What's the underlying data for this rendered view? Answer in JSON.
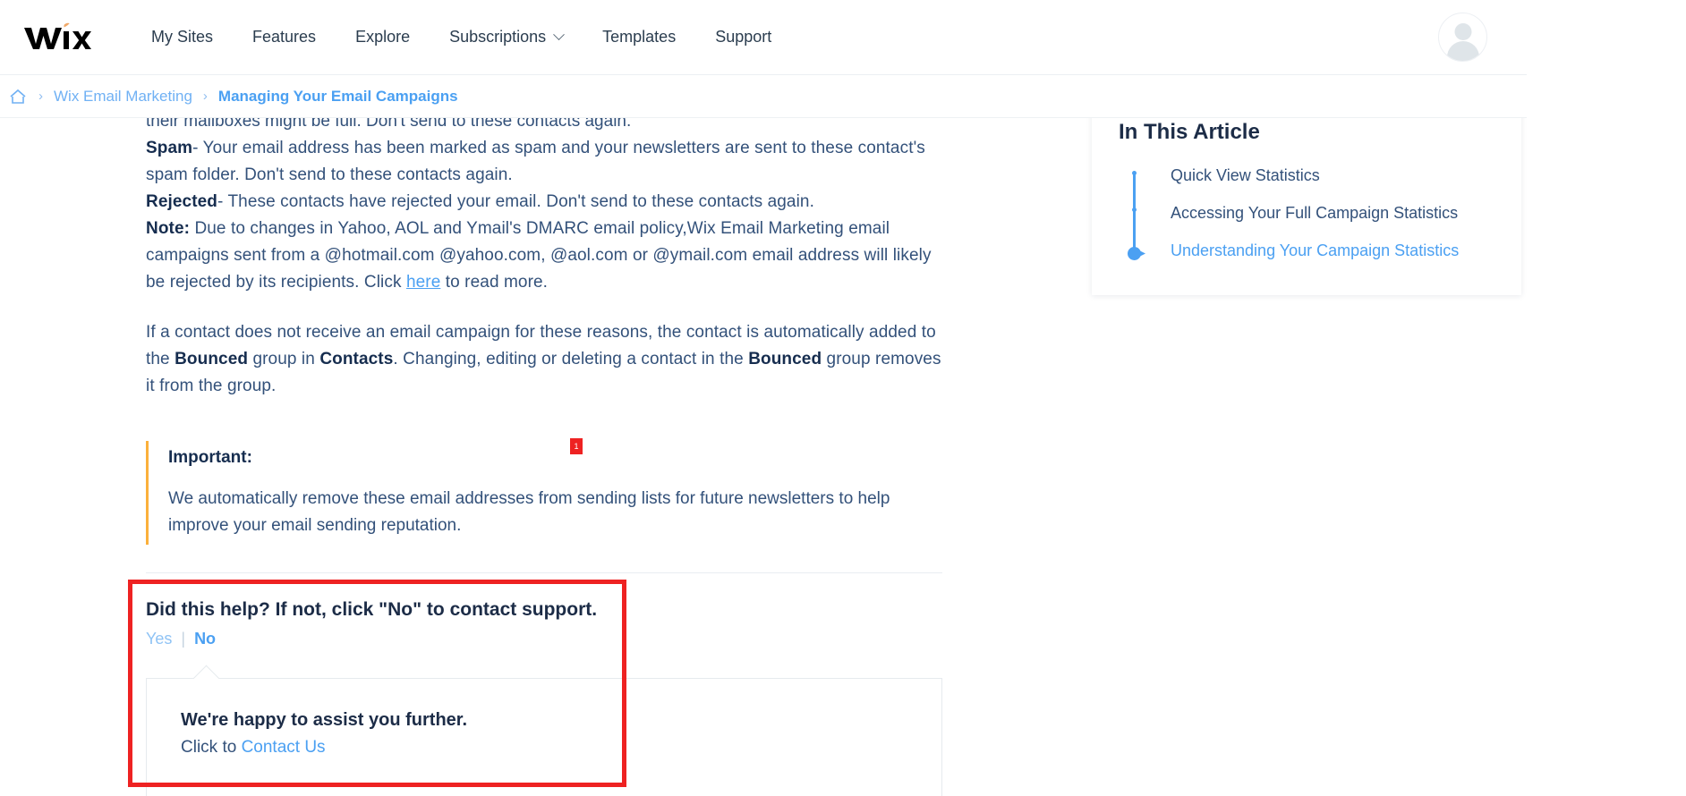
{
  "header": {
    "logo_text": "WiX",
    "nav": [
      {
        "label": "My Sites",
        "has_caret": false
      },
      {
        "label": "Features",
        "has_caret": false
      },
      {
        "label": "Explore",
        "has_caret": false
      },
      {
        "label": "Subscriptions",
        "has_caret": true
      },
      {
        "label": "Templates",
        "has_caret": false
      },
      {
        "label": "Support",
        "has_caret": false
      }
    ],
    "avatar_name": "user-avatar"
  },
  "breadcrumb": {
    "home_icon": "home-icon",
    "separator": "›",
    "items": [
      {
        "label": "Wix Email Marketing",
        "current": false
      },
      {
        "label": "Managing Your Email Campaigns",
        "current": true
      }
    ]
  },
  "article": {
    "clipped_line": "their mailboxes might be full. Don't send to these contacts again.",
    "spam_label": "Spam",
    "spam_text": "- Your email address has been marked as spam and your newsletters are sent to these contact's spam folder. Don't send to these contacts again.",
    "rejected_label": "Rejected",
    "rejected_text": "- These contacts have rejected your email. Don't send to these contacts again.",
    "note_label": "Note:",
    "note_text_1": " Due to changes in Yahoo, AOL and Ymail's DMARC email policy,Wix Email Marketing email campaigns sent from a @hotmail.com @yahoo.com, @aol.com or @ymail.com email address will likely be rejected by its recipients. Click ",
    "note_link": "here",
    "note_text_2": " to read more.",
    "bounced_p1": "If a contact does not receive an email campaign for these reasons, the contact is automatically added to the ",
    "bounced_b1": "Bounced",
    "bounced_p2": " group in ",
    "bounced_b2": "Contacts",
    "bounced_p3": ". Changing, editing or deleting a contact in the ",
    "bounced_b3": "Bounced",
    "bounced_p4": " group removes it from the group.",
    "callout_title": "Important:",
    "callout_body": "We automatically remove these email addresses from sending lists for future newsletters to help improve your email sending reputation.",
    "red_marker_label": "1"
  },
  "feedback": {
    "question": "Did this help? If not, click \"No\" to contact support.",
    "yes_label": "Yes",
    "separator": "|",
    "no_label": "No",
    "assist_title": "We're happy to assist you further.",
    "assist_prefix": "Click to ",
    "assist_link": "Contact Us"
  },
  "toc": {
    "title": "In This Article",
    "items": [
      {
        "label": "Quick View Statistics",
        "active": false
      },
      {
        "label": "Accessing Your Full Campaign Statistics",
        "active": false
      },
      {
        "label": "Understanding Your Campaign Statistics",
        "active": true
      }
    ]
  },
  "colors": {
    "link": "#4ba0f2",
    "text": "#33517a",
    "heading": "#1c2c47",
    "highlight": "#ee2222",
    "callout_bar": "#fbb03b"
  }
}
